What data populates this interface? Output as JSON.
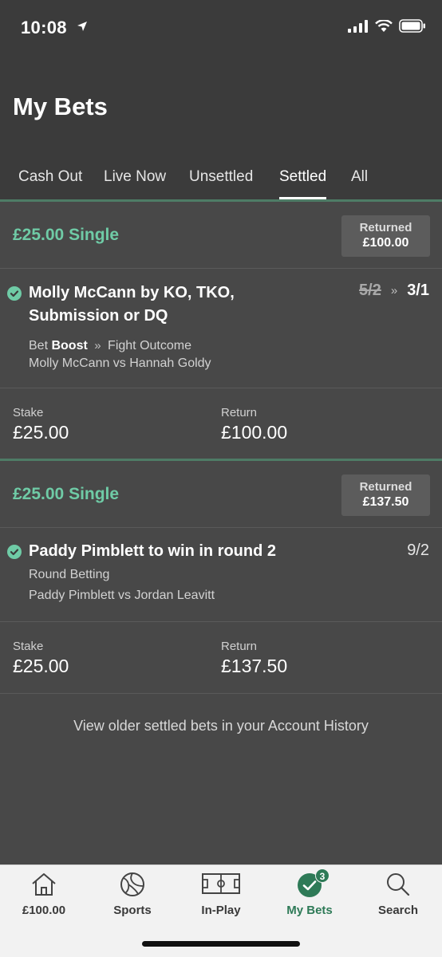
{
  "status_bar": {
    "time": "10:08"
  },
  "header": {
    "title": "My Bets"
  },
  "tabs": [
    {
      "label": "Cash Out"
    },
    {
      "label": "Live Now"
    },
    {
      "label": "Unsettled"
    },
    {
      "label": "Settled",
      "active": true
    },
    {
      "label": "All"
    }
  ],
  "bets": [
    {
      "type": "£25.00 Single",
      "returned_label": "Returned",
      "returned_amount": "£100.00",
      "selection": {
        "name_line1": "Molly McCann by KO, TKO,",
        "name_line2": "Submission or DQ",
        "odds_old": "5/2",
        "odds_new": "3/1",
        "market_prefix": "Bet",
        "market_boost": "Boost",
        "market": "Fight Outcome",
        "event": "Molly McCann vs Hannah Goldy"
      },
      "stake_label": "Stake",
      "stake": "£25.00",
      "return_label": "Return",
      "return": "£100.00"
    },
    {
      "type": "£25.00 Single",
      "returned_label": "Returned",
      "returned_amount": "£137.50",
      "selection": {
        "name_line1": "Paddy Pimblett to win in round 2",
        "odds": "9/2",
        "market": "Round Betting",
        "event": "Paddy Pimblett vs Jordan Leavitt"
      },
      "stake_label": "Stake",
      "stake": "£25.00",
      "return_label": "Return",
      "return": "£137.50"
    }
  ],
  "history_link": "View older settled bets in your Account History",
  "tabbar": [
    {
      "label": "£100.00",
      "icon": "home-icon"
    },
    {
      "label": "Sports",
      "icon": "ball-icon"
    },
    {
      "label": "In-Play",
      "icon": "pitch-icon"
    },
    {
      "label": "My Bets",
      "icon": "check-circle-icon",
      "badge": "3",
      "active": true
    },
    {
      "label": "Search",
      "icon": "search-icon"
    }
  ],
  "colors": {
    "accent": "#6fcba6",
    "brand_green": "#2e7a57",
    "background": "#484848",
    "header": "#3b3b3b"
  }
}
